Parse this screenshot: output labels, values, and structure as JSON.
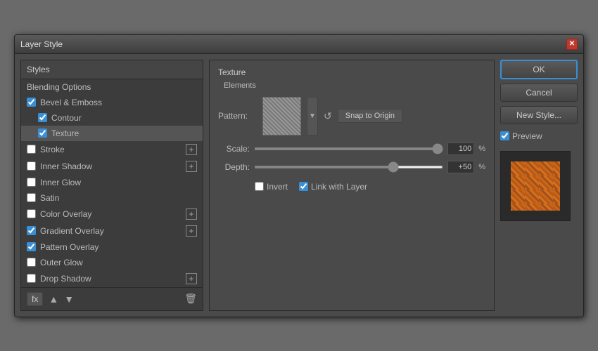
{
  "dialog": {
    "title": "Layer Style",
    "close_label": "✕"
  },
  "left_panel": {
    "header": "Styles",
    "items": [
      {
        "id": "blending-options",
        "label": "Blending Options",
        "checked": null,
        "has_plus": false,
        "indent": 0
      },
      {
        "id": "bevel-emboss",
        "label": "Bevel & Emboss",
        "checked": true,
        "has_plus": false,
        "indent": 0
      },
      {
        "id": "contour",
        "label": "Contour",
        "checked": true,
        "has_plus": false,
        "indent": 1
      },
      {
        "id": "texture",
        "label": "Texture",
        "checked": true,
        "has_plus": false,
        "indent": 1,
        "active": true
      },
      {
        "id": "stroke",
        "label": "Stroke",
        "checked": false,
        "has_plus": true,
        "indent": 0
      },
      {
        "id": "inner-shadow",
        "label": "Inner Shadow",
        "checked": false,
        "has_plus": true,
        "indent": 0
      },
      {
        "id": "inner-glow",
        "label": "Inner Glow",
        "checked": false,
        "has_plus": false,
        "indent": 0
      },
      {
        "id": "satin",
        "label": "Satin",
        "checked": false,
        "has_plus": false,
        "indent": 0
      },
      {
        "id": "color-overlay",
        "label": "Color Overlay",
        "checked": false,
        "has_plus": true,
        "indent": 0
      },
      {
        "id": "gradient-overlay",
        "label": "Gradient Overlay",
        "checked": true,
        "has_plus": true,
        "indent": 0
      },
      {
        "id": "pattern-overlay",
        "label": "Pattern Overlay",
        "checked": true,
        "has_plus": false,
        "indent": 0
      },
      {
        "id": "outer-glow",
        "label": "Outer Glow",
        "checked": false,
        "has_plus": false,
        "indent": 0
      },
      {
        "id": "drop-shadow",
        "label": "Drop Shadow",
        "checked": false,
        "has_plus": true,
        "indent": 0
      }
    ],
    "footer": {
      "fx_label": "fx",
      "up_label": "▲",
      "down_label": "▼",
      "trash_label": "🗑"
    }
  },
  "middle_panel": {
    "section_title": "Texture",
    "section_subtitle": "Elements",
    "pattern_label": "Pattern:",
    "snap_btn": "Snap to Origin",
    "scale_label": "Scale:",
    "scale_value": "100",
    "scale_unit": "%",
    "depth_label": "Depth:",
    "depth_value": "+50",
    "depth_unit": "%",
    "invert_label": "Invert",
    "link_layer_label": "Link with Layer",
    "invert_checked": false,
    "link_checked": true
  },
  "right_panel": {
    "ok_label": "OK",
    "cancel_label": "Cancel",
    "new_style_label": "New Style...",
    "preview_label": "Preview",
    "preview_checked": true
  },
  "colors": {
    "accent_blue": "#3a8fd4",
    "bg_dark": "#3c3c3c",
    "bg_mid": "#4a4a4a"
  }
}
